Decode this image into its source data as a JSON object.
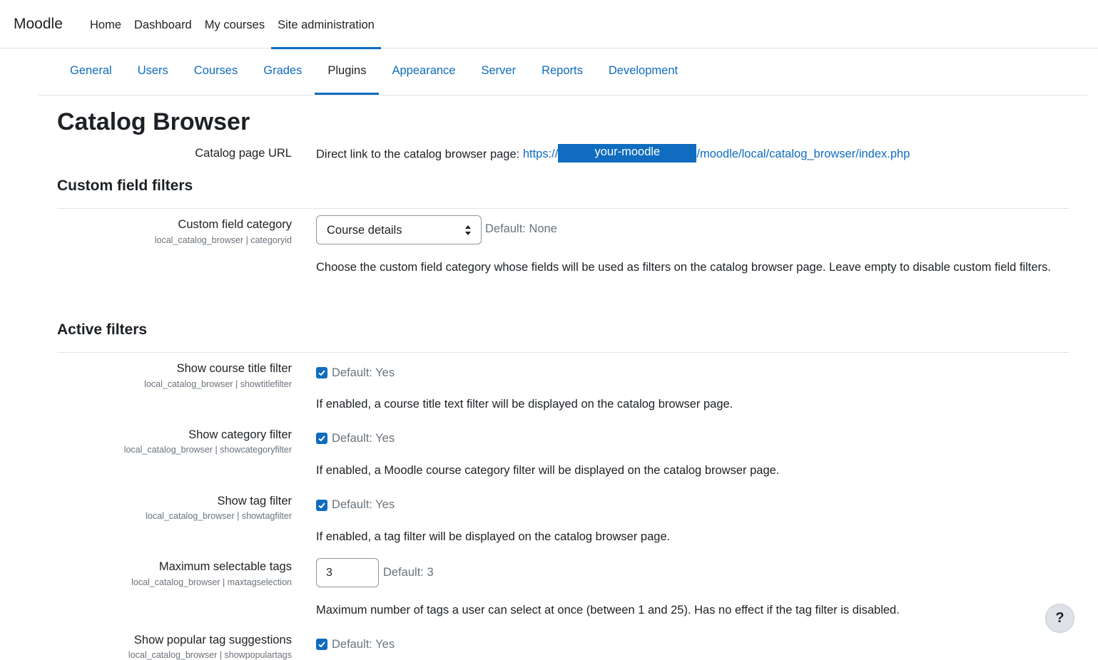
{
  "header": {
    "brand": "Moodle",
    "nav": [
      "Home",
      "Dashboard",
      "My courses",
      "Site administration"
    ]
  },
  "secondary_nav": [
    "General",
    "Users",
    "Courses",
    "Grades",
    "Plugins",
    "Appearance",
    "Server",
    "Reports",
    "Development"
  ],
  "page": {
    "title": "Catalog Browser",
    "catalog_url": {
      "label": "Catalog page URL",
      "prefix": "Direct link to the catalog browser page: ",
      "url_start": "https://",
      "redacted": "your-moodle",
      "url_end": "/moodle/local/catalog_browser/index.php"
    },
    "custom_field_filters": {
      "heading": "Custom field filters",
      "label": "Custom field category",
      "sublabel": "local_catalog_browser | categoryid",
      "select_value": "Course details",
      "default": "Default: None",
      "description": "Choose the custom field category whose fields will be used as filters on the catalog browser page. Leave empty to disable custom field filters."
    },
    "active_filters": {
      "heading": "Active filters",
      "title_filter": {
        "label": "Show course title filter",
        "sublabel": "local_catalog_browser | showtitlefilter",
        "default": "Default: Yes",
        "description": "If enabled, a course title text filter will be displayed on the catalog browser page."
      },
      "category_filter": {
        "label": "Show category filter",
        "sublabel": "local_catalog_browser | showcategoryfilter",
        "default": "Default: Yes",
        "description": "If enabled, a Moodle course category filter will be displayed on the catalog browser page."
      },
      "tag_filter": {
        "label": "Show tag filter",
        "sublabel": "local_catalog_browser | showtagfilter",
        "default": "Default: Yes",
        "description": "If enabled, a tag filter will be displayed on the catalog browser page."
      },
      "max_tags": {
        "label": "Maximum selectable tags",
        "sublabel": "local_catalog_browser | maxtagselection",
        "value": "3",
        "default": "Default: 3",
        "description": "Maximum number of tags a user can select at once (between 1 and 25). Has no effect if the tag filter is disabled."
      },
      "popular_tags": {
        "label": "Show popular tag suggestions",
        "sublabel": "local_catalog_browser | showpopulartags",
        "default": "Default: Yes"
      }
    }
  },
  "help_button": "?",
  "colors": {
    "accent": "#0f6cbf",
    "text": "#1d2125",
    "muted": "#6a737b",
    "border": "#dee2e6"
  }
}
